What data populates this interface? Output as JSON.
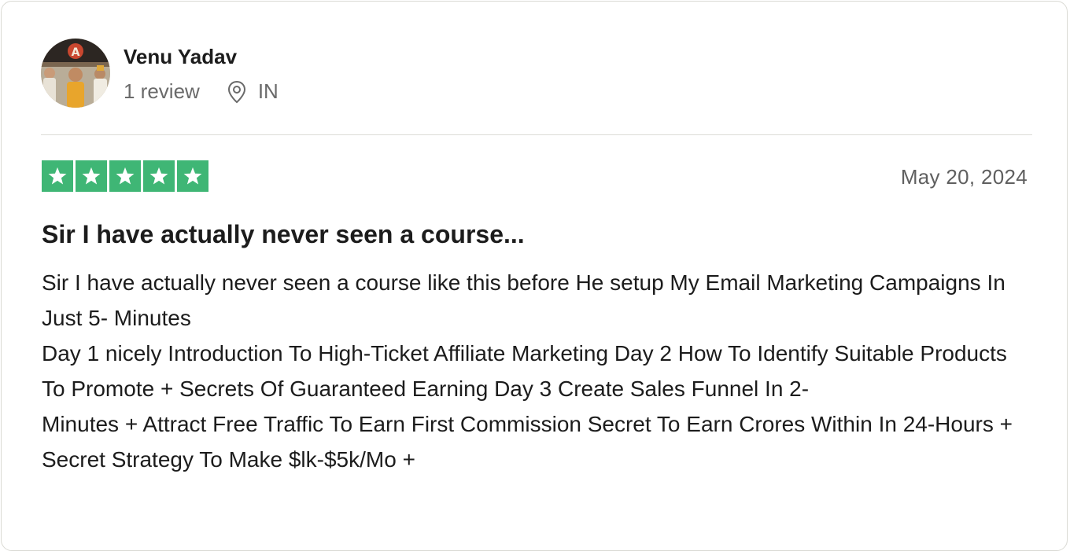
{
  "reviewer": {
    "name": "Venu Yadav",
    "reviews_count": "1 review",
    "country": "IN"
  },
  "rating": {
    "stars": 5,
    "max": 5,
    "color": "#3fb675"
  },
  "review": {
    "date": "May 20, 2024",
    "title": "Sir I have actually never seen a course...",
    "body_lines": [
      "Sir I have actually never seen a course like this before He setup My Email Marketing Campaigns In Just 5- Minutes",
      "Day 1 nicely Introduction To High-Ticket Affiliate Marketing Day 2 How To Identify Suitable Products To Promote + Secrets Of Guaranteed Earning Day 3 Create Sales Funnel In 2-",
      "Minutes + Attract Free Traffic To Earn First Commission Secret To Earn Crores Within In 24-Hours + Secret Strategy To Make $lk-$5k/Mo +"
    ]
  },
  "icons": {
    "location": "location-pin-icon",
    "star": "star-icon"
  }
}
